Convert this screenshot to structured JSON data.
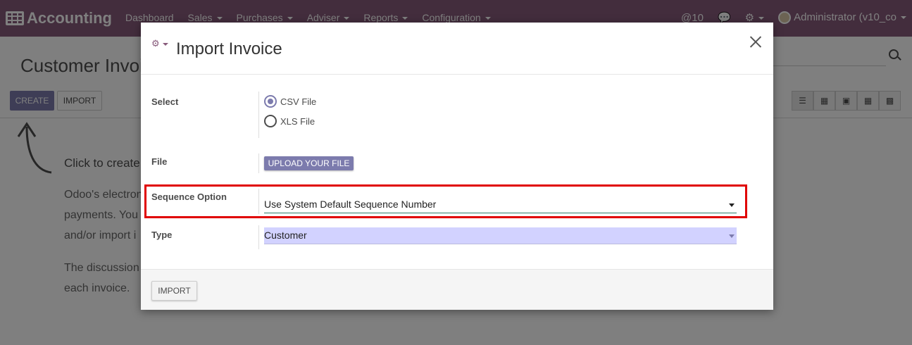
{
  "navbar": {
    "brand": "Accounting",
    "menu": [
      "Dashboard",
      "Sales",
      "Purchases",
      "Adviser",
      "Reports",
      "Configuration"
    ],
    "notifications": "@10",
    "user": "Administrator (v10_co"
  },
  "control_panel": {
    "title": "Customer Invoi",
    "create_label": "CREATE",
    "import_label": "IMPORT"
  },
  "help": {
    "title": "Click to create",
    "lines": [
      "Odoo's electron",
      "payments. You",
      "and/or import i",
      "The discussion",
      "each invoice."
    ]
  },
  "modal": {
    "title": "Import Invoice",
    "fields": {
      "select_label": "Select",
      "options": [
        "CSV File",
        "XLS File"
      ],
      "file_label": "File",
      "upload_label": "UPLOAD YOUR FILE",
      "sequence_label": "Sequence Option",
      "sequence_value": "Use System Default Sequence Number",
      "type_label": "Type",
      "type_value": "Customer"
    },
    "import_button": "IMPORT"
  },
  "colors": {
    "brand": "#875a7b",
    "primary": "#7c7bad",
    "highlight": "#e00000"
  }
}
